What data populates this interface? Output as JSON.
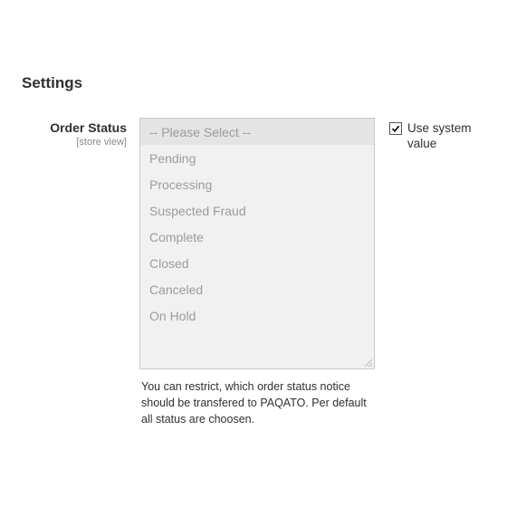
{
  "section_title": "Settings",
  "field": {
    "label": "Order Status",
    "scope": "[store view]",
    "help": "You can restrict, which order status notice should be transfered to PAQATO. Per default all status are choosen."
  },
  "listbox": {
    "options": [
      "-- Please Select --",
      "Pending",
      "Processing",
      "Suspected Fraud",
      "Complete",
      "Closed",
      "Canceled",
      "On Hold"
    ],
    "selected_index": 0,
    "disabled": true
  },
  "use_system": {
    "label": "Use system value",
    "checked": true
  }
}
